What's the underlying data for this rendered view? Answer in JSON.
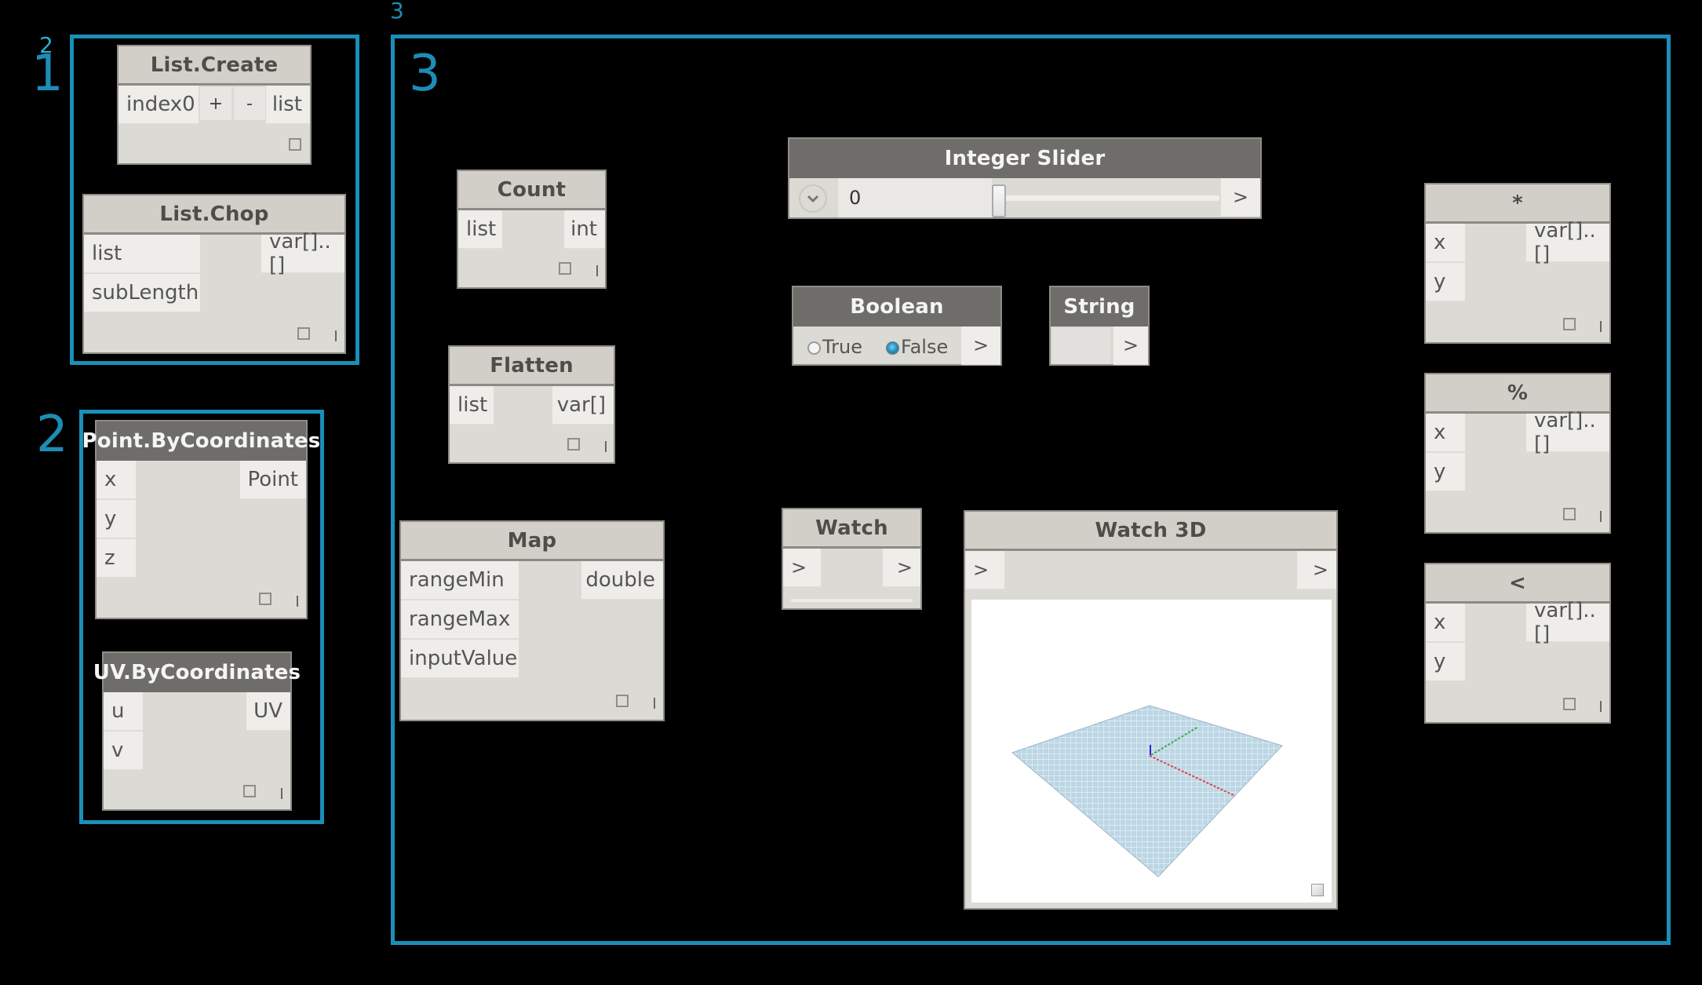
{
  "groups": [
    {
      "label": "1",
      "sub_label": "2"
    },
    {
      "label": "2"
    },
    {
      "label": "3",
      "top_label": "3"
    }
  ],
  "nodes": {
    "list_create": {
      "title": "List.Create",
      "inputs": [
        "index0"
      ],
      "add_label": "+",
      "remove_label": "-",
      "outputs": [
        "list"
      ]
    },
    "list_chop": {
      "title": "List.Chop",
      "inputs": [
        "list",
        "subLength"
      ],
      "outputs": [
        "var[]..[]"
      ]
    },
    "point_by_coordinates": {
      "title": "Point.ByCoordinates",
      "inputs": [
        "x",
        "y",
        "z"
      ],
      "outputs": [
        "Point"
      ]
    },
    "uv_by_coordinates": {
      "title": "UV.ByCoordinates",
      "inputs": [
        "u",
        "v"
      ],
      "outputs": [
        "UV"
      ]
    },
    "count": {
      "title": "Count",
      "inputs": [
        "list"
      ],
      "outputs": [
        "int"
      ]
    },
    "flatten": {
      "title": "Flatten",
      "inputs": [
        "list"
      ],
      "outputs": [
        "var[]"
      ]
    },
    "map": {
      "title": "Map",
      "inputs": [
        "rangeMin",
        "rangeMax",
        "inputValue"
      ],
      "outputs": [
        "double"
      ]
    },
    "integer_slider": {
      "title": "Integer Slider",
      "value": "0",
      "slider_fraction": 0.0,
      "output": ">"
    },
    "boolean": {
      "title": "Boolean",
      "options": [
        "True",
        "False"
      ],
      "selected": "False",
      "output": ">"
    },
    "string": {
      "title": "String",
      "value": "",
      "output": ">"
    },
    "watch": {
      "title": "Watch",
      "input": ">",
      "output": ">"
    },
    "watch_3d": {
      "title": "Watch 3D",
      "input": ">",
      "output": ">"
    },
    "multiply": {
      "title": "*",
      "inputs": [
        "x",
        "y"
      ],
      "outputs": [
        "var[]..[]"
      ]
    },
    "modulo": {
      "title": "%",
      "inputs": [
        "x",
        "y"
      ],
      "outputs": [
        "var[]..[]"
      ]
    },
    "less_than": {
      "title": "<",
      "inputs": [
        "x",
        "y"
      ],
      "outputs": [
        "var[]..[]"
      ]
    }
  },
  "colors": {
    "group_border": "#1a8fb8",
    "node_body": "#dcdad4",
    "node_header_light": "#d2cfc9",
    "node_header_dark": "#6e6d6a",
    "canvas": "#000000"
  }
}
